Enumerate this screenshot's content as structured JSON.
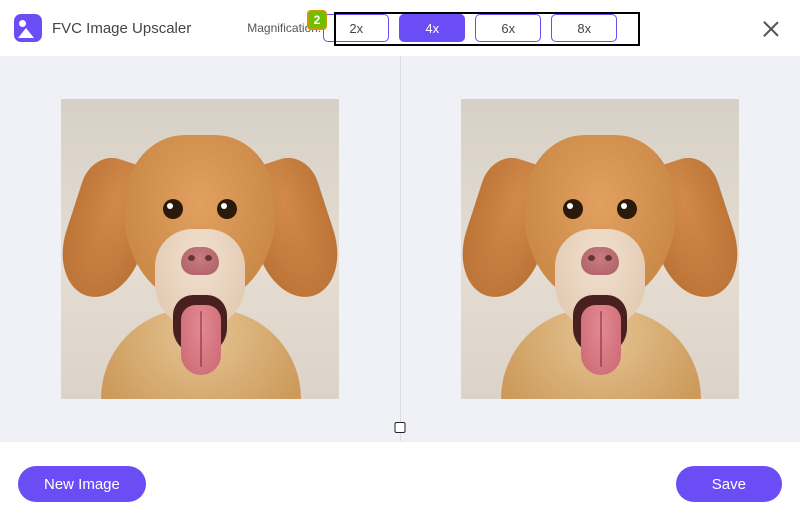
{
  "header": {
    "app_title": "FVC Image Upscaler",
    "magnification_label": "Magnification:",
    "options": [
      "2x",
      "4x",
      "6x",
      "8x"
    ],
    "selected_index": 1,
    "close_icon": "close-icon"
  },
  "annotation": {
    "badge_number": "2"
  },
  "panes": {
    "left_image": "dog-original",
    "right_image": "dog-upscaled",
    "resize_handle": "resize-handle"
  },
  "footer": {
    "new_image_label": "New Image",
    "save_label": "Save"
  },
  "colors": {
    "accent": "#6a4df5",
    "panel_bg": "#f0f1f6"
  }
}
